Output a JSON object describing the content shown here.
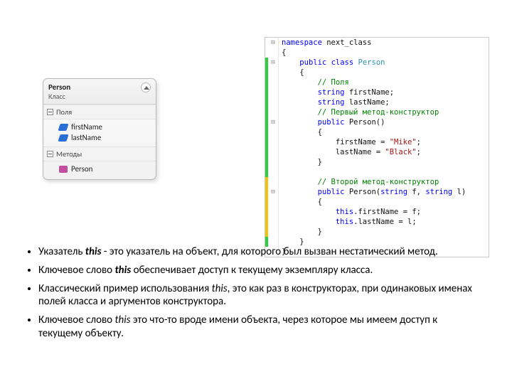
{
  "diagram": {
    "name": "Person",
    "kind": "Класс",
    "section_fields": "Поля",
    "fields": [
      "firstName",
      "lastName"
    ],
    "section_methods": "Методы",
    "methods": [
      "Person"
    ]
  },
  "code": {
    "lines": [
      {
        "mk": "",
        "fold": "⊟",
        "t": [
          {
            "c": "kw",
            "s": "namespace"
          },
          {
            "s": " next_class"
          }
        ]
      },
      {
        "mk": "",
        "fold": "",
        "t": [
          {
            "s": "{"
          }
        ]
      },
      {
        "mk": "g",
        "fold": "⊟",
        "t": [
          {
            "s": "    "
          },
          {
            "c": "kw",
            "s": "public"
          },
          {
            "s": " "
          },
          {
            "c": "kw",
            "s": "class"
          },
          {
            "s": " "
          },
          {
            "c": "typ",
            "s": "Person"
          }
        ]
      },
      {
        "mk": "g",
        "fold": "",
        "t": [
          {
            "s": "    {"
          }
        ]
      },
      {
        "mk": "g",
        "fold": "",
        "t": [
          {
            "s": "        "
          },
          {
            "c": "cm",
            "s": "// Поля"
          }
        ]
      },
      {
        "mk": "g",
        "fold": "",
        "t": [
          {
            "s": "        "
          },
          {
            "c": "kw",
            "s": "string"
          },
          {
            "s": " firstName;"
          }
        ]
      },
      {
        "mk": "g",
        "fold": "",
        "t": [
          {
            "s": "        "
          },
          {
            "c": "kw",
            "s": "string"
          },
          {
            "s": " lastName;"
          }
        ]
      },
      {
        "mk": "g",
        "fold": "",
        "t": [
          {
            "s": "        "
          },
          {
            "c": "cm",
            "s": "// Первый метод-конструктор"
          }
        ]
      },
      {
        "mk": "g",
        "fold": "⊟",
        "t": [
          {
            "s": "        "
          },
          {
            "c": "kw",
            "s": "public"
          },
          {
            "s": " Person()"
          }
        ]
      },
      {
        "mk": "g",
        "fold": "",
        "t": [
          {
            "s": "        {"
          }
        ]
      },
      {
        "mk": "g",
        "fold": "",
        "t": [
          {
            "s": "            firstName = "
          },
          {
            "c": "str",
            "s": "\"Mike\""
          },
          {
            "s": ";"
          }
        ]
      },
      {
        "mk": "g",
        "fold": "",
        "t": [
          {
            "s": "            lastName = "
          },
          {
            "c": "str",
            "s": "\"Black\""
          },
          {
            "s": ";"
          }
        ]
      },
      {
        "mk": "g",
        "fold": "",
        "t": [
          {
            "s": "        }"
          }
        ]
      },
      {
        "mk": "g",
        "fold": "",
        "t": [
          {
            "s": ""
          }
        ]
      },
      {
        "mk": "y",
        "fold": "",
        "t": [
          {
            "s": "        "
          },
          {
            "c": "cm",
            "s": "// Второй метод-конструктор"
          }
        ]
      },
      {
        "mk": "y",
        "fold": "⊟",
        "t": [
          {
            "s": "        "
          },
          {
            "c": "kw",
            "s": "public"
          },
          {
            "s": " Person("
          },
          {
            "c": "kw",
            "s": "string"
          },
          {
            "s": " f, "
          },
          {
            "c": "kw",
            "s": "string"
          },
          {
            "s": " l)"
          }
        ]
      },
      {
        "mk": "y",
        "fold": "",
        "t": [
          {
            "s": "        {"
          }
        ]
      },
      {
        "mk": "y",
        "fold": "",
        "t": [
          {
            "s": "            "
          },
          {
            "c": "kw",
            "s": "this"
          },
          {
            "s": ".firstName = f;"
          }
        ]
      },
      {
        "mk": "y",
        "fold": "",
        "t": [
          {
            "s": "            "
          },
          {
            "c": "kw",
            "s": "this"
          },
          {
            "s": ".lastName = l;"
          }
        ]
      },
      {
        "mk": "y",
        "fold": "",
        "t": [
          {
            "s": "        }"
          }
        ]
      },
      {
        "mk": "g",
        "fold": "",
        "t": [
          {
            "s": "    }"
          }
        ]
      },
      {
        "mk": "",
        "fold": "",
        "t": [
          {
            "s": "}"
          }
        ]
      }
    ]
  },
  "bullets": [
    "Указатель <em class='kw'>this</em> - это указатель на объект, для которого был вызван нестатический метод.",
    " Ключевое слово <em class='kw'>this</em> обеспечивает доступ к текущему экземпляру класса.",
    "Классический пример использования <em class='kwi'>this</em>, это как раз в конструкторах, при одинаковых именах полей класса и аргументов конструктора.",
    "Ключевое слово <em class='kwi'>this</em> это что-то вроде имени объекта, через которое мы имеем доступ к текущему объекту."
  ]
}
